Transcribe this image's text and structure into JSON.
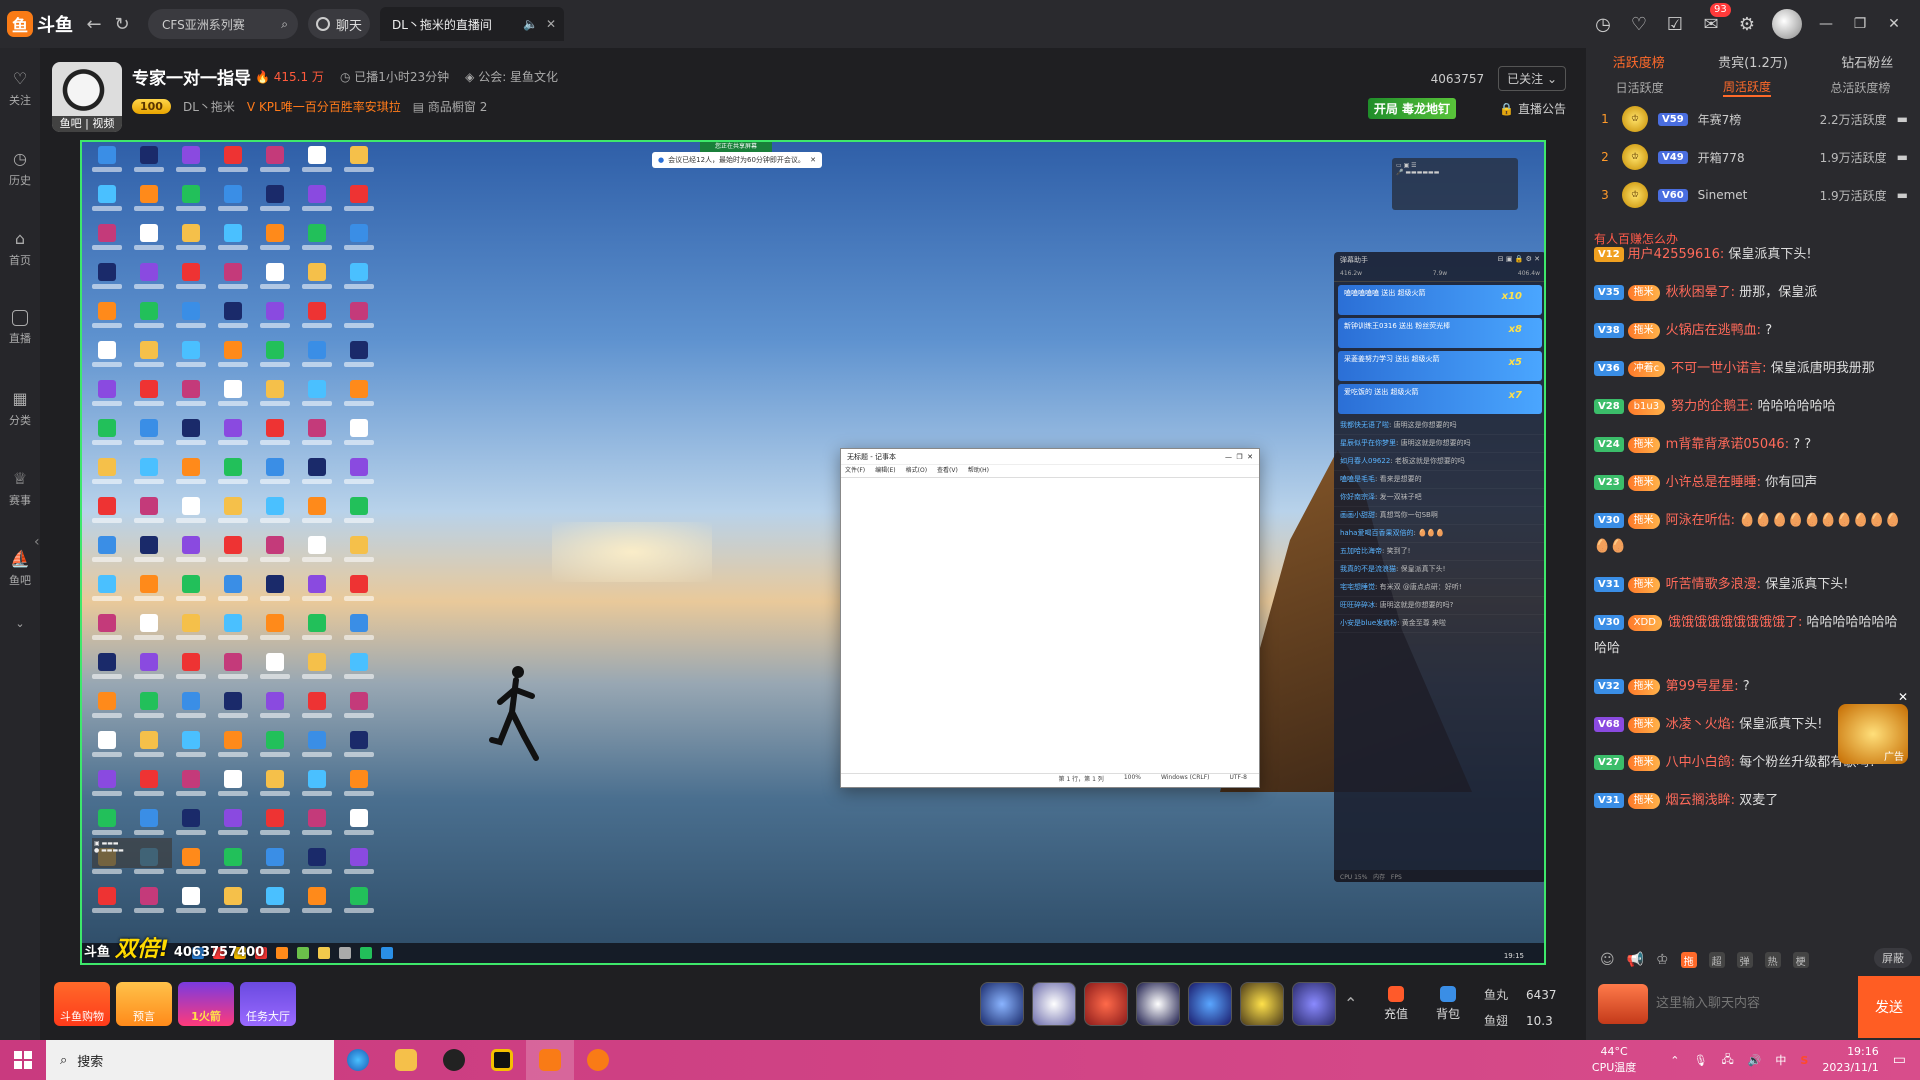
{
  "topbar": {
    "logo_text": "斗鱼",
    "search_tab": "CFS亚洲系列赛",
    "chat_label": "聊天",
    "active_tab": "DL丶拖米的直播间",
    "notif_count": "93"
  },
  "leftnav": [
    {
      "label": "关注",
      "icon": "heart-icon"
    },
    {
      "label": "历史",
      "icon": "clock-icon"
    },
    {
      "label": "首页",
      "icon": "home-icon"
    },
    {
      "label": "直播",
      "icon": "tv-icon"
    },
    {
      "label": "分类",
      "icon": "grid-icon"
    },
    {
      "label": "赛事",
      "icon": "trophy-icon"
    },
    {
      "label": "鱼吧",
      "icon": "fish-icon"
    }
  ],
  "room": {
    "title": "专家一对一指导",
    "hot": "415.1 万",
    "duration": "已播1小时23分钟",
    "guild": "公会: 星鱼文化",
    "level": "100",
    "anchor": "DL丶拖米",
    "kpl": "KPL唯一百分百胜率安琪拉",
    "shop": "商品橱窗 2",
    "room_id": "4063757",
    "follow": "已关注",
    "notice": "直播公告",
    "poison": "开局 毒龙地钉",
    "avatar_label": "鱼吧 | 视频"
  },
  "video": {
    "share_bar": "会议已经12人，最始时为60分钟即开会议。",
    "share_tag": "您正在共享屏幕",
    "notepad_title": "无标题 - 记事本",
    "notepad_menu": [
      "文件(F)",
      "编辑(E)",
      "格式(O)",
      "查看(V)",
      "帮助(H)"
    ],
    "notepad_status": [
      "第 1 行，第 1 列",
      "100%",
      "Windows (CRLF)",
      "UTF-8"
    ],
    "watermark_prefix": "斗鱼",
    "watermark_word": "双倍!",
    "watermark_id": "4063757400",
    "stream_clock": "19:15",
    "dmk_title": "弹幕助手",
    "dmk_stats": [
      "416.2w",
      "7.9w",
      "406.4w"
    ],
    "gifts": [
      {
        "text": "嗑嗑嗑嗑嗑 送出 超级火箭",
        "count": "x10"
      },
      {
        "text": "新钟训练王0316 送出 粉丝荧光棒",
        "count": "x8"
      },
      {
        "text": "采菱姜努力学习 送出 超级火箭",
        "count": "x5"
      },
      {
        "text": "爱吃饭的 送出 超级火箭",
        "count": "x7"
      }
    ],
    "dmk_lines": [
      {
        "name": "我都快无语了啦",
        "text": "唐明这是你想要的吗"
      },
      {
        "name": "星辰似乎在你梦里",
        "text": "唐明这就是你想要的吗"
      },
      {
        "name": "如月春人09622",
        "text": "老板这就是你想要的吗"
      },
      {
        "name": "嗑嗑是毛毛",
        "text": "看来是想要的"
      },
      {
        "name": "你好南宗泽",
        "text": "发一双袜子吧"
      },
      {
        "name": "画画小甜甜",
        "text": "真想骂你一句SB啊"
      },
      {
        "name": "haha爱喝百香果双倍的",
        "text": "🥚🥚🥚"
      },
      {
        "name": "五加哈比海帝",
        "text": "笑到了!"
      },
      {
        "name": "我真的不是流浪猫",
        "text": "保皇派真下头!"
      },
      {
        "name": "宅宅想睡觉",
        "text": "有米双 @唐点点研：好听!"
      },
      {
        "name": "旺旺碎碎冰",
        "text": "唐明这就是你想要的吗?"
      },
      {
        "name": "小安是blue发疯粉",
        "text": "黄金至尊 来啦"
      }
    ]
  },
  "giftbar": {
    "promos": [
      "斗鱼购物",
      "预言",
      "1火箭",
      "任务大厅"
    ],
    "recharge": "充值",
    "backpack": "背包",
    "fish_ball_label": "鱼丸",
    "fish_ball": "6437",
    "fish_fin_label": "鱼翅",
    "fish_fin": "10.3"
  },
  "right": {
    "rank_tabs": [
      "活跃度榜",
      "贵宾(1.2万)",
      "钻石粉丝"
    ],
    "sub_tabs": [
      "日活跃度",
      "周活跃度",
      "总活跃度榜"
    ],
    "ranks": [
      {
        "num": "1",
        "lv": "59",
        "name": "年赛7榜",
        "score": "2.2万活跃度"
      },
      {
        "num": "2",
        "lv": "49",
        "name": "开箱778",
        "score": "1.9万活跃度"
      },
      {
        "num": "3",
        "lv": "60",
        "name": "Sinemet",
        "score": "1.9万活跃度"
      }
    ],
    "top_notice": "有人百赚怎么办",
    "messages": [
      {
        "lv": "12",
        "lvcolor": "#f0a020",
        "fan": "",
        "user": "用户42559616:",
        "text": "保皇派真下头!"
      },
      {
        "lv": "35",
        "lvcolor": "#3a8ee6",
        "fan": "拖米",
        "user": "秋秋困晕了:",
        "text": "册那，保皇派"
      },
      {
        "lv": "38",
        "lvcolor": "#3a8ee6",
        "fan": "拖米",
        "user": "火锅店在逃鸭血:",
        "text": "?"
      },
      {
        "lv": "36",
        "lvcolor": "#3a8ee6",
        "fan": "冲着c",
        "user": "不可一世小诺言:",
        "text": "保皇派唐明我册那"
      },
      {
        "lv": "28",
        "lvcolor": "#3bbd6a",
        "fan": "b1u3",
        "user": "努力的企鹅王:",
        "text": "哈哈哈哈哈哈"
      },
      {
        "lv": "24",
        "lvcolor": "#3bbd6a",
        "fan": "拖米",
        "user": "m背靠背承诺05046:",
        "text": "? ?"
      },
      {
        "lv": "23",
        "lvcolor": "#3bbd6a",
        "fan": "拖米",
        "user": "小许总是在睡睡:",
        "text": "你有回声"
      },
      {
        "lv": "30",
        "lvcolor": "#3a8ee6",
        "fan": "拖米",
        "user": "阿泳在听估:",
        "text": "🥚🥚🥚🥚🥚🥚🥚🥚🥚🥚🥚🥚"
      },
      {
        "lv": "31",
        "lvcolor": "#3a8ee6",
        "fan": "拖米",
        "user": "听苦情歌多浪漫:",
        "text": "保皇派真下头!"
      },
      {
        "lv": "30",
        "lvcolor": "#3a8ee6",
        "fan": "XDD",
        "user": "饿饿饿饿饿饿饿饿饿了:",
        "text": "哈哈哈哈哈哈哈哈哈"
      },
      {
        "lv": "32",
        "lvcolor": "#3a8ee6",
        "fan": "拖米",
        "user": "第99号星星:",
        "text": "?"
      },
      {
        "lv": "68",
        "lvcolor": "#8a4ae0",
        "fan": "拖米",
        "user": "冰凌丶火焰:",
        "text": "保皇派真下头!"
      },
      {
        "lv": "27",
        "lvcolor": "#3bbd6a",
        "fan": "拖米",
        "user": "八中小白鸽:",
        "text": "每个粉丝升级都有歌吗?"
      },
      {
        "lv": "31",
        "lvcolor": "#3a8ee6",
        "fan": "拖米",
        "user": "烟云搁浅眸:",
        "text": "双麦了"
      }
    ],
    "tools": [
      "超",
      "弹",
      "热",
      "梗"
    ],
    "shield": "屏蔽",
    "input_placeholder": "这里输入聊天内容",
    "send": "发送",
    "ad_label": "广告"
  },
  "taskbar": {
    "search": "搜索",
    "temp": "44°C",
    "temp_label": "CPU温度",
    "time": "19:16",
    "date": "2023/11/1",
    "ime": "中"
  }
}
